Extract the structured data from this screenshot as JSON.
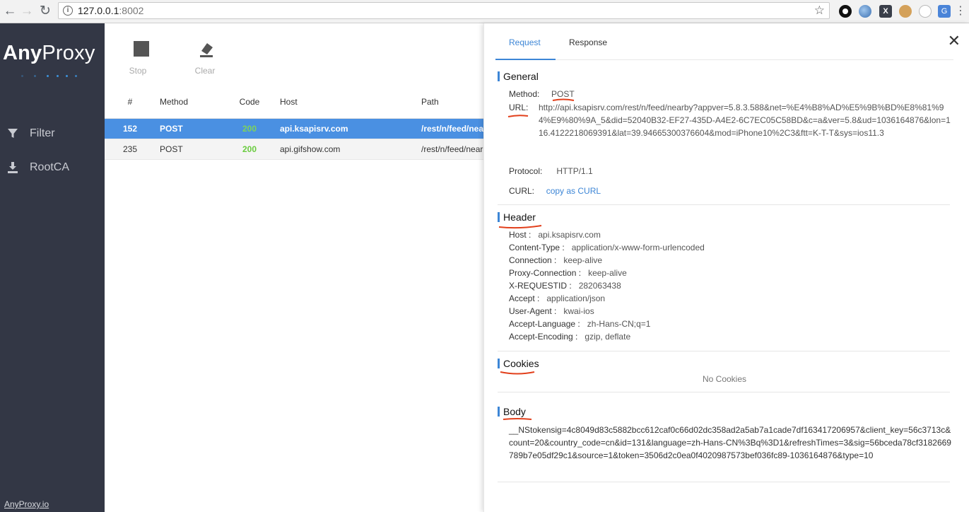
{
  "browser": {
    "url_host": "127.0.0.1",
    "url_port": ":8002"
  },
  "sidebar": {
    "logo_bold": "Any",
    "logo_light": "Proxy",
    "items": [
      {
        "label": "Filter",
        "icon": "filter-icon"
      },
      {
        "label": "RootCA",
        "icon": "download-icon"
      }
    ],
    "footer_link": "AnyProxy.io"
  },
  "toolbar": {
    "stop_label": "Stop",
    "clear_label": "Clear"
  },
  "table": {
    "headers": [
      "#",
      "Method",
      "Code",
      "Host",
      "Path"
    ],
    "rows": [
      {
        "id": "152",
        "method": "POST",
        "code": "200",
        "host": "api.ksapisrv.com",
        "path": "/rest/n/feed/nearby",
        "selected": true
      },
      {
        "id": "235",
        "method": "POST",
        "code": "200",
        "host": "api.gifshow.com",
        "path": "/rest/n/feed/nearby",
        "selected": false
      }
    ]
  },
  "detail": {
    "tabs": [
      "Request",
      "Response"
    ],
    "active_tab": "Request",
    "general": {
      "title": "General",
      "method_key": "Method:",
      "method_value": "POST",
      "url_key": "URL:",
      "url_value": "http://api.ksapisrv.com/rest/n/feed/nearby?appver=5.8.3.588&net=%E4%B8%AD%E5%9B%BD%E8%81%94%E9%80%9A_5&did=52040B32-EF27-435D-A4E2-6C7EC05C58BD&c=a&ver=5.8&ud=1036164876&lon=116.4122218069391&lat=39.94665300376604&mod=iPhone10%2C3&ftt=K-T-T&sys=ios11.3",
      "protocol_key": "Protocol:",
      "protocol_value": "HTTP/1.1",
      "curl_key": "CURL:",
      "curl_link": "copy as CURL"
    },
    "header": {
      "title": "Header",
      "entries": [
        {
          "k": "Host :",
          "v": "api.ksapisrv.com"
        },
        {
          "k": "Content-Type :",
          "v": "application/x-www-form-urlencoded"
        },
        {
          "k": "Connection :",
          "v": "keep-alive"
        },
        {
          "k": "Proxy-Connection :",
          "v": "keep-alive"
        },
        {
          "k": "X-REQUESTID :",
          "v": "282063438"
        },
        {
          "k": "Accept :",
          "v": "application/json"
        },
        {
          "k": "User-Agent :",
          "v": "kwai-ios"
        },
        {
          "k": "Accept-Language :",
          "v": "zh-Hans-CN;q=1"
        },
        {
          "k": "Accept-Encoding :",
          "v": "gzip, deflate"
        }
      ]
    },
    "cookies": {
      "title": "Cookies",
      "empty_text": "No Cookies"
    },
    "body": {
      "title": "Body",
      "content": "__NStokensig=4c8049d83c5882bcc612caf0c66d02dc358ad2a5ab7a1cade7df163417206957&client_key=56c3713c&count=20&country_code=cn&id=131&language=zh-Hans-CN%3Bq%3D1&refreshTimes=3&sig=56bceda78cf3182669789b7e05df29c1&source=1&token=3506d2c0ea0f4020987573bef036fc89-1036164876&type=10"
    }
  },
  "colors": {
    "sidebar_bg": "#333745",
    "accent": "#3d86d6",
    "selected_row": "#4a90e2",
    "status_ok": "#6acb3f",
    "annotation": "#e2401c"
  }
}
